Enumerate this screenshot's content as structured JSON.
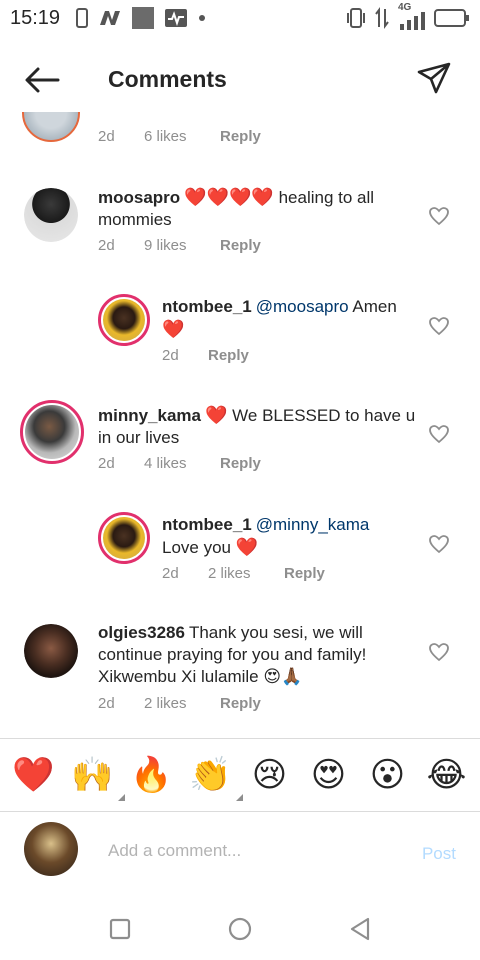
{
  "status_bar": {
    "time": "15:19",
    "network": "4G"
  },
  "header": {
    "title": "Comments"
  },
  "comments": [
    {
      "meta": {
        "time": "2d",
        "likes": "6 likes",
        "reply": "Reply"
      }
    },
    {
      "username": "moosapro",
      "hearts": "❤️❤️❤️❤️",
      "text": "healing to all mommies",
      "meta": {
        "time": "2d",
        "likes": "9 likes",
        "reply": "Reply"
      }
    },
    {
      "username": "ntombee_1",
      "mention": "@moosapro",
      "text": "Amen",
      "heart": "❤️",
      "meta": {
        "time": "2d",
        "reply": "Reply"
      }
    },
    {
      "username": "minny_kama",
      "heart": "❤️",
      "text": "We BLESSED to have u in our lives",
      "meta": {
        "time": "2d",
        "likes": "4 likes",
        "reply": "Reply"
      }
    },
    {
      "username": "ntombee_1",
      "mention": "@minny_kama",
      "text": "Love you",
      "heart": "❤️",
      "meta": {
        "time": "2d",
        "likes": "2 likes",
        "reply": "Reply"
      }
    },
    {
      "username": "olgies3286",
      "text": "Thank you sesi, we will continue praying for you and family! Xikwembu Xi lulamile",
      "emojis": "😍🙏🏾",
      "meta": {
        "time": "2d",
        "likes": "2 likes",
        "reply": "Reply"
      }
    }
  ],
  "emoji_bar": [
    "❤️",
    "🙌",
    "🔥",
    "👏",
    "😢",
    "😍",
    "😮",
    "😂"
  ],
  "composer": {
    "placeholder": "Add a comment...",
    "post_label": "Post"
  },
  "colors": {
    "accent_link": "#00376b",
    "heart": "#ed4956",
    "post_disabled": "#b3dbff",
    "meta_gray": "#8e8e8e"
  }
}
